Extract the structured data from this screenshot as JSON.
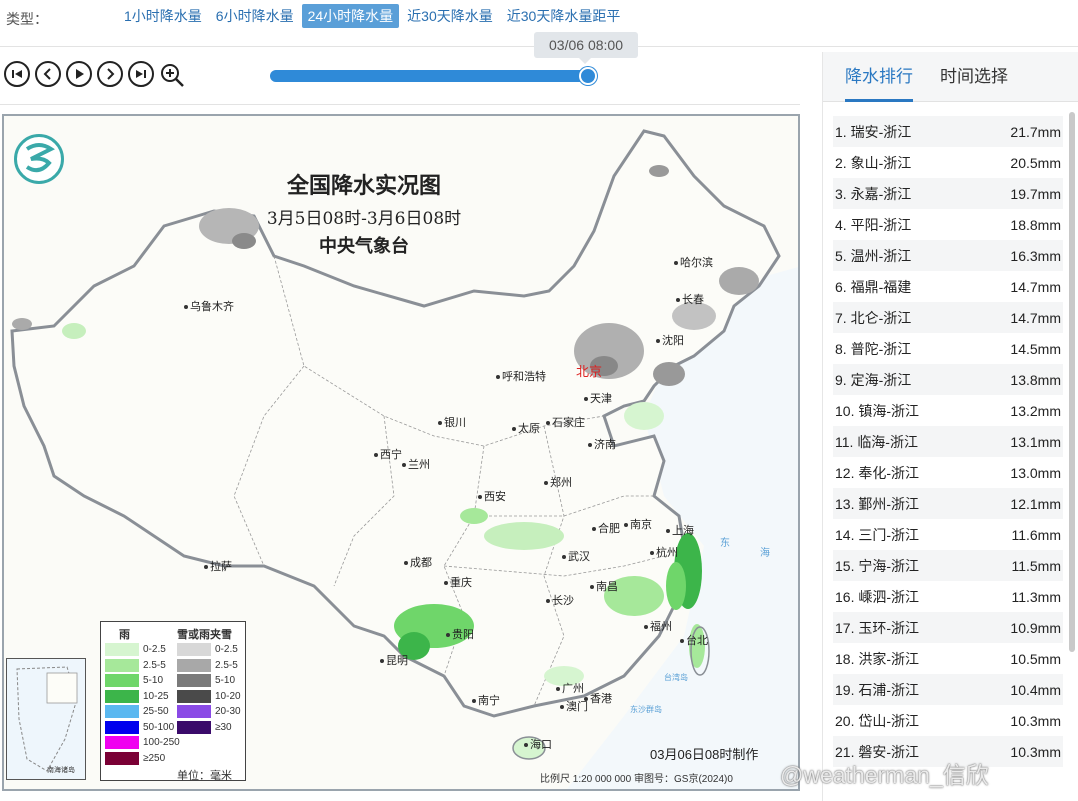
{
  "typebar": {
    "label": "类型：",
    "tabs": [
      {
        "label": "1小时降水量",
        "active": false
      },
      {
        "label": "6小时降水量",
        "active": false
      },
      {
        "label": "24小时降水量",
        "active": true
      },
      {
        "label": "近30天降水量",
        "active": false
      },
      {
        "label": "近30天降水量距平",
        "active": false
      }
    ]
  },
  "player": {
    "buttons": [
      "first-icon",
      "prev-icon",
      "play-icon",
      "next-icon",
      "last-icon"
    ],
    "zoom": "zoom-in-icon",
    "time_tooltip": "03/06 08:00",
    "progress": 1.0
  },
  "map": {
    "title": "全国降水实况图",
    "subtitle": "3月5日08时-3月6日08时",
    "org": "中央气象台",
    "cities": [
      {
        "name": "乌鲁木齐"
      },
      {
        "name": "哈尔滨"
      },
      {
        "name": "长春"
      },
      {
        "name": "沈阳"
      },
      {
        "name": "北京",
        "capital": true
      },
      {
        "name": "天津"
      },
      {
        "name": "呼和浩特"
      },
      {
        "name": "石家庄"
      },
      {
        "name": "太原"
      },
      {
        "name": "银川"
      },
      {
        "name": "济南"
      },
      {
        "name": "西宁"
      },
      {
        "name": "兰州"
      },
      {
        "name": "郑州"
      },
      {
        "name": "西安"
      },
      {
        "name": "合肥"
      },
      {
        "name": "南京"
      },
      {
        "name": "上海"
      },
      {
        "name": "成都"
      },
      {
        "name": "武汉"
      },
      {
        "name": "杭州"
      },
      {
        "name": "拉萨"
      },
      {
        "name": "重庆"
      },
      {
        "name": "长沙"
      },
      {
        "name": "南昌"
      },
      {
        "name": "贵阳"
      },
      {
        "name": "福州"
      },
      {
        "name": "台北"
      },
      {
        "name": "昆明"
      },
      {
        "name": "广州"
      },
      {
        "name": "香港"
      },
      {
        "name": "澳门"
      },
      {
        "name": "南宁"
      },
      {
        "name": "海口"
      }
    ],
    "seas": [
      "东",
      "海",
      "台湾岛",
      "东沙群岛"
    ],
    "legend": {
      "rain_title": "雨",
      "rain": [
        {
          "label": "0-2.5",
          "color": "#d6f5d0"
        },
        {
          "label": "2.5-5",
          "color": "#a6e89a"
        },
        {
          "label": "5-10",
          "color": "#6fd66a"
        },
        {
          "label": "10-25",
          "color": "#3cb54a"
        },
        {
          "label": "25-50",
          "color": "#5bb8f0"
        },
        {
          "label": "50-100",
          "color": "#0000ee"
        },
        {
          "label": "100-250",
          "color": "#f000f0"
        },
        {
          "label": "≥250",
          "color": "#7a0035"
        }
      ],
      "snow_title": "雪或雨夹雪",
      "snow": [
        {
          "label": "0-2.5",
          "color": "#d8d8d8"
        },
        {
          "label": "2.5-5",
          "color": "#a8a8a8"
        },
        {
          "label": "5-10",
          "color": "#7a7a7a"
        },
        {
          "label": "10-20",
          "color": "#4a4a4a"
        },
        {
          "label": "20-30",
          "color": "#8a4ae6"
        },
        {
          "label": "≥30",
          "color": "#3a0a6a"
        }
      ],
      "unit": "单位：毫米"
    },
    "inset_label": "南海诸岛",
    "made": "03月06日08时制作",
    "scale": "比例尺 1:20 000 000",
    "review": "审图号：GS京(2024)0"
  },
  "panel": {
    "tabs": [
      {
        "label": "降水排行",
        "active": true
      },
      {
        "label": "时间选择",
        "active": false
      }
    ],
    "ranking": [
      {
        "rank": "1. 瑞安-浙江",
        "value": "21.7mm"
      },
      {
        "rank": "2. 象山-浙江",
        "value": "20.5mm"
      },
      {
        "rank": "3. 永嘉-浙江",
        "value": "19.7mm"
      },
      {
        "rank": "4. 平阳-浙江",
        "value": "18.8mm"
      },
      {
        "rank": "5. 温州-浙江",
        "value": "16.3mm"
      },
      {
        "rank": "6. 福鼎-福建",
        "value": "14.7mm"
      },
      {
        "rank": "7. 北仑-浙江",
        "value": "14.7mm"
      },
      {
        "rank": "8. 普陀-浙江",
        "value": "14.5mm"
      },
      {
        "rank": "9. 定海-浙江",
        "value": "13.8mm"
      },
      {
        "rank": "10. 镇海-浙江",
        "value": "13.2mm"
      },
      {
        "rank": "11. 临海-浙江",
        "value": "13.1mm"
      },
      {
        "rank": "12. 奉化-浙江",
        "value": "13.0mm"
      },
      {
        "rank": "13. 鄞州-浙江",
        "value": "12.1mm"
      },
      {
        "rank": "14. 三门-浙江",
        "value": "11.6mm"
      },
      {
        "rank": "15. 宁海-浙江",
        "value": "11.5mm"
      },
      {
        "rank": "16. 嵊泗-浙江",
        "value": "11.3mm"
      },
      {
        "rank": "17. 玉环-浙江",
        "value": "10.9mm"
      },
      {
        "rank": "18. 洪家-浙江",
        "value": "10.5mm"
      },
      {
        "rank": "19. 石浦-浙江",
        "value": "10.4mm"
      },
      {
        "rank": "20. 岱山-浙江",
        "value": "10.3mm"
      },
      {
        "rank": "21. 磐安-浙江",
        "value": "10.3mm"
      }
    ]
  },
  "watermark": "@weatherman_信欣"
}
